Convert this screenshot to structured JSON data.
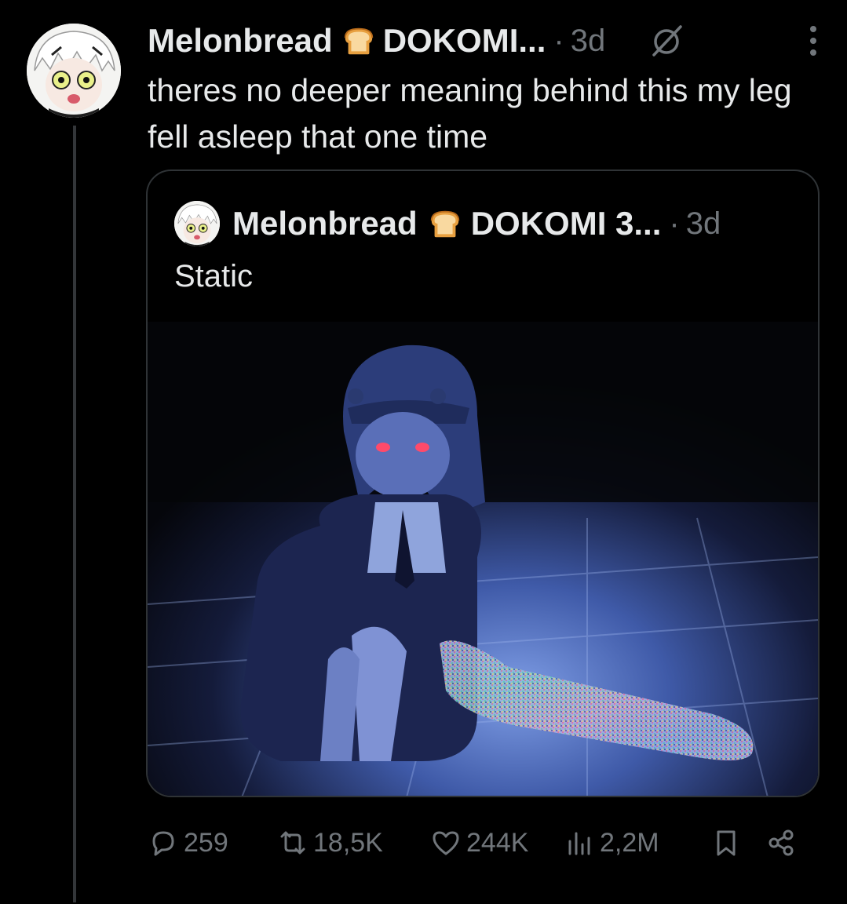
{
  "post": {
    "author_name": "Melonbread",
    "author_suffix": "DOKOMI...",
    "separator": "·",
    "time": "3d",
    "text": "theres no deeper meaning behind this my leg fell asleep that one time"
  },
  "quote": {
    "author_name": "Melonbread",
    "author_suffix": "DOKOMI 3...",
    "separator": "·",
    "time": "3d",
    "text": "Static"
  },
  "actions": {
    "replies": "259",
    "reposts": "18,5K",
    "likes": "244K",
    "views": "2,2M"
  },
  "icons": {
    "name_emoji": "bread-icon",
    "header_badge": "grok-icon",
    "menu": "more-options-icon",
    "reply": "reply-icon",
    "repost": "repost-icon",
    "like": "heart-icon",
    "views": "views-icon",
    "bookmark": "bookmark-icon",
    "share": "share-icon"
  },
  "colors": {
    "background": "#000000",
    "text_primary": "#e7e9ea",
    "text_secondary": "#71767b",
    "border": "#2f3336"
  }
}
